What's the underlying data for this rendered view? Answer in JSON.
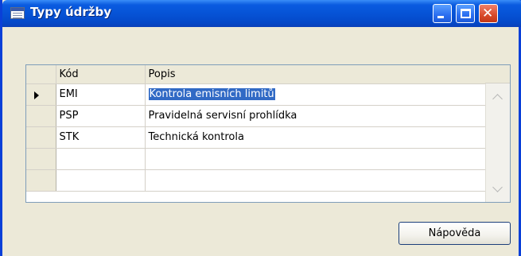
{
  "window": {
    "title": "Typy údržby",
    "icon": "table-form-icon"
  },
  "titlebar_buttons": {
    "minimize": "minimize-icon",
    "maximize": "maximize-icon",
    "close": "close-icon",
    "close_glyph": "✕"
  },
  "grid": {
    "columns": [
      "Kód",
      "Popis"
    ],
    "rows": [
      {
        "code": "EMI",
        "description": "Kontrola emisních limitů",
        "current": true,
        "selected_text": true
      },
      {
        "code": "PSP",
        "description": "Pravidelná servisní prohlídka",
        "current": false
      },
      {
        "code": "STK",
        "description": "Technická kontrola",
        "current": false
      },
      {
        "code": "",
        "description": "",
        "current": false
      },
      {
        "code": "",
        "description": "",
        "current": false
      }
    ]
  },
  "buttons": {
    "help_label": "Nápověda"
  },
  "colors": {
    "titlebar": "#0653D6",
    "selection": "#316AC5",
    "close_button": "#D84A2A"
  }
}
